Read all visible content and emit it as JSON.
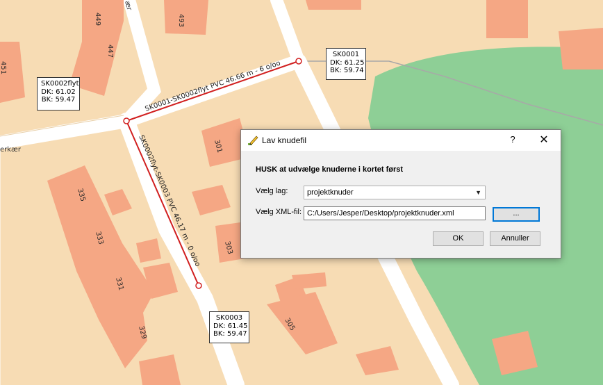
{
  "map": {
    "house_numbers": [
      "449",
      "447",
      "451",
      "493",
      "301",
      "335",
      "333",
      "331",
      "329",
      "303",
      "305"
    ],
    "road_labels": [
      "ær",
      "erkær"
    ],
    "pipes": [
      {
        "label": "SK0001-SK0002flyt  PVC  46.66 m - 6 o/oo"
      },
      {
        "label": "SK0002flyt-SK0003  PVC  46.17 m - 0 o/oo"
      }
    ],
    "nodes": [
      {
        "name": "SK0001",
        "dk": "DK: 61.25",
        "bk": "BK: 59.74"
      },
      {
        "name": "SK0002flyt",
        "dk": "DK: 61.02",
        "bk": "BK: 59.47"
      },
      {
        "name": "SK0003",
        "dk": "DK: 61.45",
        "bk": "BK: 59.47"
      }
    ],
    "colors": {
      "background": "#f7dcb4",
      "building": "#f5a784",
      "road": "#ffffff",
      "green_area": "#8ecf96",
      "pipe": "#d11f1f"
    }
  },
  "dialog": {
    "title": "Lav knudefil",
    "help_label": "?",
    "close_label": "✕",
    "heading": "HUSK at udvælge knuderne i kortet først",
    "layer_label": "Vælg lag:",
    "layer_value": "projektknuder",
    "xml_label": "Vælg XML-fil:",
    "xml_value": "C:/Users/Jesper/Desktop/projektknuder.xml",
    "browse_label": "...",
    "ok_label": "OK",
    "cancel_label": "Annuller"
  }
}
